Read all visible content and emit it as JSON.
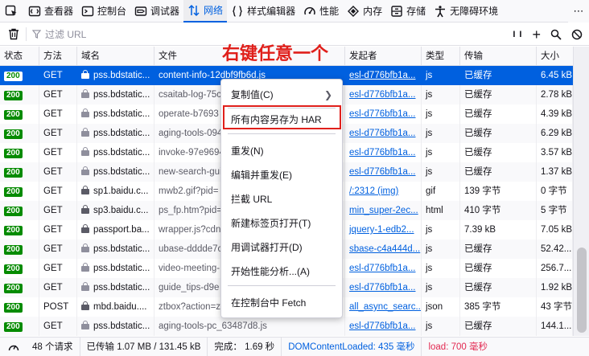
{
  "toolbar": {
    "tabs": [
      {
        "name": "inspector",
        "label": "查看器",
        "icon": "inspector-icon"
      },
      {
        "name": "console",
        "label": "控制台",
        "icon": "console-icon"
      },
      {
        "name": "debugger",
        "label": "调试器",
        "icon": "debugger-icon"
      },
      {
        "name": "network",
        "label": "网络",
        "icon": "network-icon",
        "active": true
      },
      {
        "name": "style-editor",
        "label": "样式编辑器",
        "icon": "style-editor-icon"
      },
      {
        "name": "performance",
        "label": "性能",
        "icon": "performance-icon"
      },
      {
        "name": "memory",
        "label": "内存",
        "icon": "memory-icon"
      },
      {
        "name": "storage",
        "label": "存储",
        "icon": "storage-icon"
      },
      {
        "name": "accessibility",
        "label": "无障碍环境",
        "icon": "accessibility-icon"
      }
    ],
    "more": "⋯"
  },
  "filter": {
    "placeholder": "过滤 URL",
    "pause_label": "I I",
    "add_label": "+"
  },
  "table": {
    "columns": [
      "状态",
      "方法",
      "域名",
      "文件",
      "发起者",
      "类型",
      "传输",
      "大小"
    ],
    "rows": [
      {
        "status": "200",
        "method": "GET",
        "domain": "pss.bdstatic...",
        "file": "content-info-12dbf9fb6d.js",
        "initiator": "esl-d776bfb1a...",
        "type": "js",
        "transfer": "已缓存",
        "size": "6.45 kB",
        "selected": true
      },
      {
        "status": "200",
        "method": "GET",
        "domain": "pss.bdstatic...",
        "file": "csaitab-log-75c",
        "initiator": "esl-d776bfb1a...",
        "type": "js",
        "transfer": "已缓存",
        "size": "2.78 kB"
      },
      {
        "status": "200",
        "method": "GET",
        "domain": "pss.bdstatic...",
        "file": "operate-b7693",
        "initiator": "esl-d776bfb1a...",
        "type": "js",
        "transfer": "已缓存",
        "size": "4.39 kB"
      },
      {
        "status": "200",
        "method": "GET",
        "domain": "pss.bdstatic...",
        "file": "aging-tools-094",
        "initiator": "esl-d776bfb1a...",
        "type": "js",
        "transfer": "已缓存",
        "size": "6.29 kB"
      },
      {
        "status": "200",
        "method": "GET",
        "domain": "pss.bdstatic...",
        "file": "invoke-97e9694",
        "initiator": "esl-d776bfb1a...",
        "type": "js",
        "transfer": "已缓存",
        "size": "3.57 kB"
      },
      {
        "status": "200",
        "method": "GET",
        "domain": "pss.bdstatic...",
        "file": "new-search-gui",
        "initiator": "esl-d776bfb1a...",
        "type": "js",
        "transfer": "已缓存",
        "size": "1.37 kB"
      },
      {
        "status": "200",
        "method": "GET",
        "domain": "sp1.baidu.c...",
        "file": "mwb2.gif?pid=",
        "initiator": "/:2312 (img)",
        "type": "gif",
        "transfer": "139 字节",
        "size": "0 字节"
      },
      {
        "status": "200",
        "method": "GET",
        "domain": "sp3.baidu.c...",
        "file": "ps_fp.htm?pid=",
        "initiator": "min_super-2ec...",
        "type": "html",
        "transfer": "410 字节",
        "size": "5 字节"
      },
      {
        "status": "200",
        "method": "GET",
        "domain": "passport.ba...",
        "file": "wrapper.js?cdn",
        "initiator": "jquery-1-edb2...",
        "type": "js",
        "transfer": "7.39 kB",
        "size": "7.05 kB"
      },
      {
        "status": "200",
        "method": "GET",
        "domain": "pss.bdstatic...",
        "file": "ubase-dddde7c",
        "initiator": "sbase-c4a444d...",
        "type": "js",
        "transfer": "已缓存",
        "size": "52.42..."
      },
      {
        "status": "200",
        "method": "GET",
        "domain": "pss.bdstatic...",
        "file": "video-meeting-",
        "initiator": "esl-d776bfb1a...",
        "type": "js",
        "transfer": "已缓存",
        "size": "256.7..."
      },
      {
        "status": "200",
        "method": "GET",
        "domain": "pss.bdstatic...",
        "file": "guide_tips-d9e",
        "initiator": "esl-d776bfb1a...",
        "type": "js",
        "transfer": "已缓存",
        "size": "1.92 kB"
      },
      {
        "status": "200",
        "method": "POST",
        "domain": "mbd.baidu....",
        "file": "ztbox?action=z",
        "initiator": "all_async_searc...",
        "type": "json",
        "transfer": "385 字节",
        "size": "43 字节"
      },
      {
        "status": "200",
        "method": "GET",
        "domain": "pss.bdstatic...",
        "file": "aging-tools-pc_63487d8.js",
        "initiator": "esl-d776bfb1a...",
        "type": "js",
        "transfer": "已缓存",
        "size": "144.1..."
      }
    ]
  },
  "context_menu": {
    "items": [
      {
        "label": "复制值(C)",
        "submenu": true
      },
      {
        "label": "所有内容另存为 HAR"
      },
      {
        "label": "重发(N)"
      },
      {
        "label": "编辑并重发(E)"
      },
      {
        "label": "拦截 URL"
      },
      {
        "label": "新建标签页打开(T)"
      },
      {
        "label": "用调试器打开(D)"
      },
      {
        "label": "开始性能分析...(A)"
      },
      {
        "label": "在控制台中 Fetch"
      }
    ]
  },
  "annotation": "右键任意一个",
  "statusbar": {
    "requests": "48 个请求",
    "transferred": "已传输 1.07 MB / 131.45 kB",
    "finish": "完成： 1.69 秒",
    "dcl": "DOMContentLoaded: 435 毫秒",
    "load": "load: 700 毫秒"
  },
  "colors": {
    "accent": "#0060df",
    "status_ok": "#058b00",
    "annotation_red": "#e0201b",
    "load_red": "#e22850"
  }
}
